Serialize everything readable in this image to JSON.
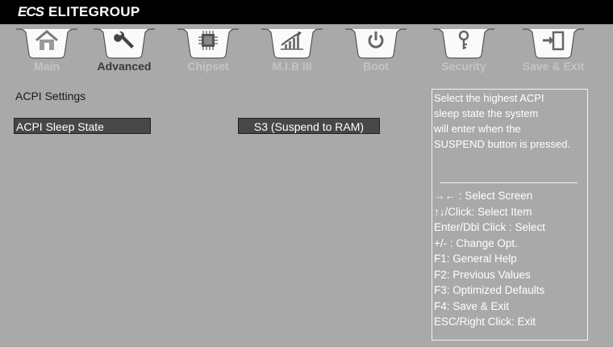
{
  "header": {
    "logo_text": "ECS",
    "brand_name": "ELITEGROUP"
  },
  "tabs": [
    {
      "label": "Main",
      "icon": "home-icon",
      "active": false
    },
    {
      "label": "Advanced",
      "icon": "wrench-icon",
      "active": true
    },
    {
      "label": "Chipset",
      "icon": "chip-icon",
      "active": false
    },
    {
      "label": "M.I.B III",
      "icon": "performance-chart-icon",
      "active": false
    },
    {
      "label": "Boot",
      "icon": "power-icon",
      "active": false
    },
    {
      "label": "Security",
      "icon": "key-icon",
      "active": false
    },
    {
      "label": "Save & Exit",
      "icon": "exit-door-icon",
      "active": false
    }
  ],
  "main": {
    "section_title": "ACPI Settings",
    "setting": {
      "label": "ACPI Sleep State",
      "value": "S3 (Suspend to RAM)"
    }
  },
  "help": {
    "description": [
      "Select the highest ACPI",
      "sleep state the system",
      "will enter when the",
      "SUSPEND button is pressed."
    ],
    "keys": [
      "→←  : Select Screen",
      "↑↓/Click: Select Item",
      "Enter/Dbl Click : Select",
      "+/- : Change Opt.",
      "F1: General Help",
      "F2: Previous Values",
      "F3: Optimized Defaults",
      "F4: Save & Exit",
      "ESC/Right Click: Exit"
    ]
  },
  "colors": {
    "background": "#a9a9a9",
    "topbar": "#000000",
    "field": "#474747",
    "active_tab_label": "#3a3a3a",
    "inactive_tab_label": "#c4c4c4"
  }
}
